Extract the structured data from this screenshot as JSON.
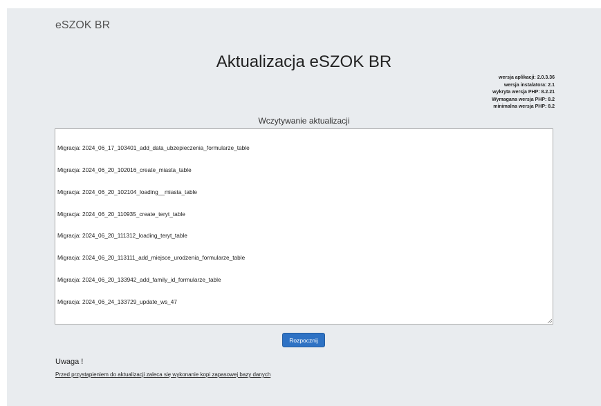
{
  "header": {
    "brand": "eSZOK BR"
  },
  "main": {
    "title": "Aktualizacja eSZOK BR",
    "versions": [
      "wersja aplikacji: 2.0.3.36",
      "wersja instalatora: 2.1",
      "wykryta wersja PHP: 8.2.21",
      "Wymagana wersja PHP: 8.2",
      "minimalna wersja PHP: 8.2"
    ],
    "subtitle": "Wczytywanie aktualizacji",
    "log_lines": [
      "Migracja: 2024_06_17_103401_add_data_ubzepieczenia_formularze_table",
      "Migracja: 2024_06_20_102016_create_miasta_table",
      "Migracja: 2024_06_20_102104_loading__miasta_table",
      "Migracja: 2024_06_20_110935_create_teryt_table",
      "Migracja: 2024_06_20_111312_loading_teryt_table",
      "Migracja: 2024_06_20_113111_add_miejsce_urodzenia_formularze_table",
      "Migracja: 2024_06_20_133942_add_family_id_formularze_table",
      "Migracja: 2024_06_24_133729_update_ws_47"
    ],
    "start_button": "Rozpocznij",
    "warning_title": "Uwaga !",
    "warning_text": "Przed przystąpieniem do aktualizacji zaleca się wykonanie kopi zapasowej bazy danych"
  }
}
